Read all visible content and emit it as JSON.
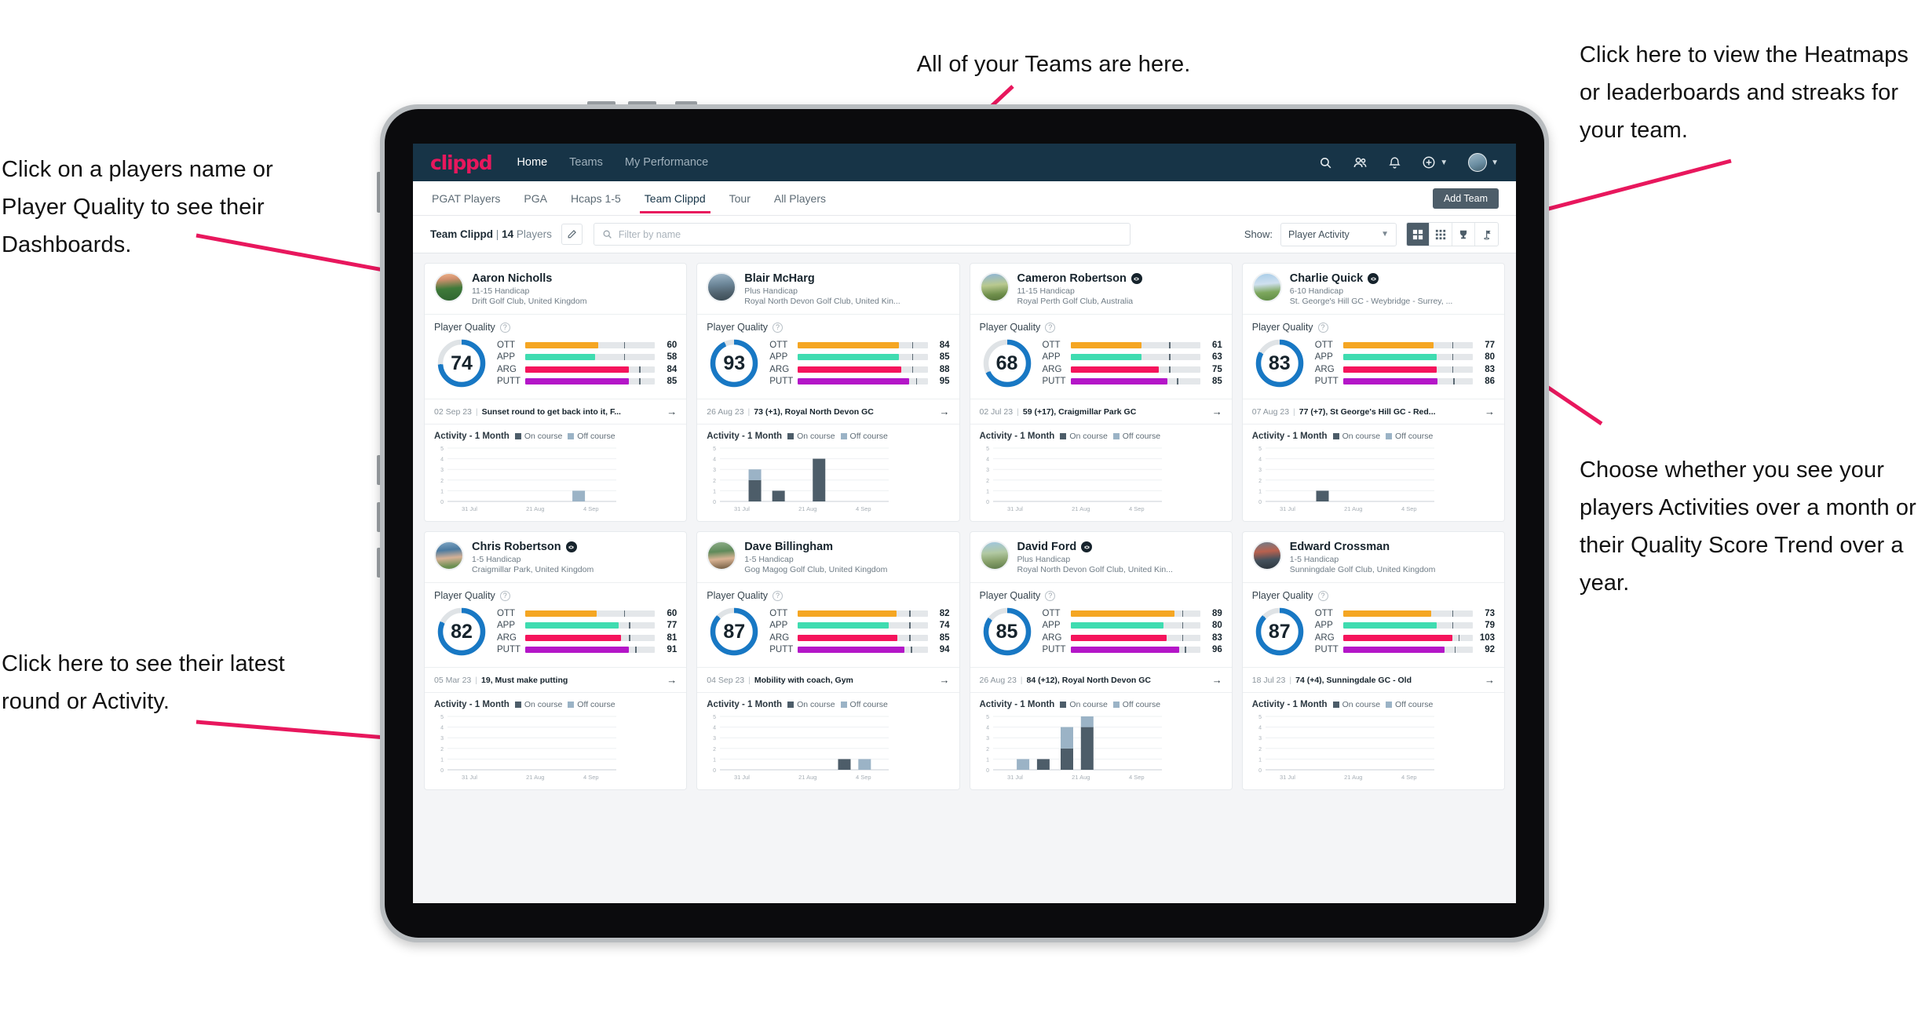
{
  "annotations": [
    {
      "id": "players-name",
      "text": "Click on a players name or Player Quality to see their Dashboards."
    },
    {
      "id": "teams",
      "text": "All of your Teams are here."
    },
    {
      "id": "heatmaps",
      "text": "Click here to view the Heatmaps or leaderboards and streaks for your team."
    },
    {
      "id": "activity-toggle",
      "text": "Choose whether you see your players Activities over a month or their Quality Score Trend over a year."
    },
    {
      "id": "latest-round",
      "text": "Click here to see their latest round or Activity."
    }
  ],
  "colors": {
    "brand_pink": "#e8175d",
    "header_navy": "#173447",
    "ring_blue": "#1878c4",
    "ott": "#f5a623",
    "app": "#3fdcb0",
    "arg": "#f5145c",
    "putt": "#b416c8",
    "on_course": "#4d5d69",
    "off_course": "#9bb3c6",
    "button_gray": "#4d5d69"
  },
  "app": {
    "logo": "clippd",
    "nav": [
      {
        "label": "Home",
        "active": true
      },
      {
        "label": "Teams",
        "active": false
      },
      {
        "label": "My Performance",
        "active": false
      }
    ],
    "header_icons": [
      {
        "name": "search-icon"
      },
      {
        "name": "people-icon"
      },
      {
        "name": "bell-icon"
      },
      {
        "name": "plus-circle-icon"
      },
      {
        "name": "avatar-icon"
      }
    ]
  },
  "tabs": [
    {
      "label": "PGAT Players",
      "active": false
    },
    {
      "label": "PGA",
      "active": false
    },
    {
      "label": "Hcaps 1-5",
      "active": false
    },
    {
      "label": "Team Clippd",
      "active": true
    },
    {
      "label": "Tour",
      "active": false
    },
    {
      "label": "All Players",
      "active": false
    }
  ],
  "add_team_label": "Add Team",
  "toolbar": {
    "team_name": "Team Clippd",
    "separator": "|",
    "player_count": "14",
    "players_word": "Players",
    "edit_icon": "pencil-icon",
    "filter_placeholder": "Filter by name",
    "filter_value": "",
    "show_label": "Show:",
    "show_value": "Player Activity",
    "show_options": [
      "Player Activity",
      "Quality Score Trend"
    ],
    "view_buttons": [
      {
        "name": "grid-view-icon",
        "active": true
      },
      {
        "name": "heatmap-view-icon",
        "active": false
      },
      {
        "name": "leaderboard-trophy-icon",
        "active": false
      },
      {
        "name": "streaks-flag-icon",
        "active": false
      }
    ]
  },
  "quality_section": {
    "title": "Player Quality",
    "help_icon": "question-mark-icon"
  },
  "activity_section": {
    "title": "Activity - 1 Month",
    "legend": [
      {
        "label": "On course",
        "color": "#4d5d69"
      },
      {
        "label": "Off course",
        "color": "#9bb3c6"
      }
    ],
    "y_ticks": [
      "5",
      "4",
      "3",
      "2",
      "1",
      "0"
    ],
    "x_ticks": [
      "31 Jul",
      "21 Aug",
      "4 Sep"
    ]
  },
  "metric_labels": [
    "OTT",
    "APP",
    "ARG",
    "PUTT"
  ],
  "players": [
    {
      "name": "Aaron Nicholls",
      "verified": false,
      "handicap": "11-15 Handicap",
      "club": "Drift Golf Club, United Kingdom",
      "quality_score": 74,
      "metrics": [
        {
          "label": "OTT",
          "value": 60,
          "fill_pct": 56,
          "tick_pct": 76
        },
        {
          "label": "APP",
          "value": 58,
          "fill_pct": 54,
          "tick_pct": 76
        },
        {
          "label": "ARG",
          "value": 84,
          "fill_pct": 80,
          "tick_pct": 88
        },
        {
          "label": "PUTT",
          "value": 85,
          "fill_pct": 80,
          "tick_pct": 88
        }
      ],
      "latest_date": "02 Sep 23",
      "latest_text": "Sunset round to get back into it, F...",
      "chart_data": {
        "type": "bar",
        "title": "Activity - 1 Month",
        "categories": [
          "31 Jul",
          "21 Aug",
          "4 Sep"
        ],
        "ylim": [
          0,
          5
        ],
        "bars": [
          {
            "pos": 0.74,
            "on_course": 0,
            "off_course": 1
          }
        ]
      }
    },
    {
      "name": "Blair McHarg",
      "verified": false,
      "handicap": "Plus Handicap",
      "club": "Royal North Devon Golf Club, United Kin...",
      "quality_score": 93,
      "metrics": [
        {
          "label": "OTT",
          "value": 84,
          "fill_pct": 78,
          "tick_pct": 88
        },
        {
          "label": "APP",
          "value": 85,
          "fill_pct": 78,
          "tick_pct": 88
        },
        {
          "label": "ARG",
          "value": 88,
          "fill_pct": 80,
          "tick_pct": 88
        },
        {
          "label": "PUTT",
          "value": 95,
          "fill_pct": 86,
          "tick_pct": 91
        }
      ],
      "latest_date": "26 Aug 23",
      "latest_text": "73 (+1), Royal North Devon GC",
      "chart_data": {
        "type": "bar",
        "title": "Activity - 1 Month",
        "categories": [
          "31 Jul",
          "21 Aug",
          "4 Sep"
        ],
        "ylim": [
          0,
          5
        ],
        "bars": [
          {
            "pos": 0.17,
            "on_course": 2,
            "off_course": 1
          },
          {
            "pos": 0.31,
            "on_course": 1,
            "off_course": 0
          },
          {
            "pos": 0.55,
            "on_course": 4,
            "off_course": 0
          }
        ]
      }
    },
    {
      "name": "Cameron Robertson",
      "verified": true,
      "handicap": "11-15 Handicap",
      "club": "Royal Perth Golf Club, Australia",
      "quality_score": 68,
      "metrics": [
        {
          "label": "OTT",
          "value": 61,
          "fill_pct": 55,
          "tick_pct": 76
        },
        {
          "label": "APP",
          "value": 63,
          "fill_pct": 55,
          "tick_pct": 76
        },
        {
          "label": "ARG",
          "value": 75,
          "fill_pct": 68,
          "tick_pct": 76
        },
        {
          "label": "PUTT",
          "value": 85,
          "fill_pct": 75,
          "tick_pct": 82
        }
      ],
      "latest_date": "02 Jul 23",
      "latest_text": "59 (+17), Craigmillar Park GC",
      "chart_data": {
        "type": "bar",
        "title": "Activity - 1 Month",
        "categories": [
          "31 Jul",
          "21 Aug",
          "4 Sep"
        ],
        "ylim": [
          0,
          5
        ],
        "bars": []
      }
    },
    {
      "name": "Charlie Quick",
      "verified": true,
      "handicap": "6-10 Handicap",
      "club": "St. George's Hill GC - Weybridge - Surrey, ...",
      "quality_score": 83,
      "metrics": [
        {
          "label": "OTT",
          "value": 77,
          "fill_pct": 70,
          "tick_pct": 84
        },
        {
          "label": "APP",
          "value": 80,
          "fill_pct": 72,
          "tick_pct": 84
        },
        {
          "label": "ARG",
          "value": 83,
          "fill_pct": 72,
          "tick_pct": 84
        },
        {
          "label": "PUTT",
          "value": 86,
          "fill_pct": 73,
          "tick_pct": 85
        }
      ],
      "latest_date": "07 Aug 23",
      "latest_text": "77 (+7), St George's Hill GC - Red...",
      "chart_data": {
        "type": "bar",
        "title": "Activity - 1 Month",
        "categories": [
          "31 Jul",
          "21 Aug",
          "4 Sep"
        ],
        "ylim": [
          0,
          5
        ],
        "bars": [
          {
            "pos": 0.3,
            "on_course": 1,
            "off_course": 0
          }
        ]
      }
    },
    {
      "name": "Chris Robertson",
      "verified": true,
      "handicap": "1-5 Handicap",
      "club": "Craigmillar Park, United Kingdom",
      "quality_score": 82,
      "metrics": [
        {
          "label": "OTT",
          "value": 60,
          "fill_pct": 55,
          "tick_pct": 76
        },
        {
          "label": "APP",
          "value": 77,
          "fill_pct": 72,
          "tick_pct": 80
        },
        {
          "label": "ARG",
          "value": 81,
          "fill_pct": 74,
          "tick_pct": 80
        },
        {
          "label": "PUTT",
          "value": 91,
          "fill_pct": 80,
          "tick_pct": 85
        }
      ],
      "latest_date": "05 Mar 23",
      "latest_text": "19, Must make putting",
      "chart_data": {
        "type": "bar",
        "title": "Activity - 1 Month",
        "categories": [
          "31 Jul",
          "21 Aug",
          "4 Sep"
        ],
        "ylim": [
          0,
          5
        ],
        "bars": []
      }
    },
    {
      "name": "Dave Billingham",
      "verified": false,
      "handicap": "1-5 Handicap",
      "club": "Gog Magog Golf Club, United Kingdom",
      "quality_score": 87,
      "metrics": [
        {
          "label": "OTT",
          "value": 82,
          "fill_pct": 76,
          "tick_pct": 86
        },
        {
          "label": "APP",
          "value": 74,
          "fill_pct": 70,
          "tick_pct": 86
        },
        {
          "label": "ARG",
          "value": 85,
          "fill_pct": 77,
          "tick_pct": 86
        },
        {
          "label": "PUTT",
          "value": 94,
          "fill_pct": 82,
          "tick_pct": 87
        }
      ],
      "latest_date": "04 Sep 23",
      "latest_text": "Mobility with coach, Gym",
      "chart_data": {
        "type": "bar",
        "title": "Activity - 1 Month",
        "categories": [
          "31 Jul",
          "21 Aug",
          "4 Sep"
        ],
        "ylim": [
          0,
          5
        ],
        "bars": [
          {
            "pos": 0.7,
            "on_course": 1,
            "off_course": 0
          },
          {
            "pos": 0.82,
            "on_course": 0,
            "off_course": 1
          }
        ]
      }
    },
    {
      "name": "David Ford",
      "verified": true,
      "handicap": "Plus Handicap",
      "club": "Royal North Devon Golf Club, United Kin...",
      "quality_score": 85,
      "metrics": [
        {
          "label": "OTT",
          "value": 89,
          "fill_pct": 80,
          "tick_pct": 86
        },
        {
          "label": "APP",
          "value": 80,
          "fill_pct": 72,
          "tick_pct": 86
        },
        {
          "label": "ARG",
          "value": 83,
          "fill_pct": 74,
          "tick_pct": 86
        },
        {
          "label": "PUTT",
          "value": 96,
          "fill_pct": 84,
          "tick_pct": 88
        }
      ],
      "latest_date": "26 Aug 23",
      "latest_text": "84 (+12), Royal North Devon GC",
      "chart_data": {
        "type": "bar",
        "title": "Activity - 1 Month",
        "categories": [
          "31 Jul",
          "21 Aug",
          "4 Sep"
        ],
        "ylim": [
          0,
          5
        ],
        "bars": [
          {
            "pos": 0.14,
            "on_course": 0,
            "off_course": 1
          },
          {
            "pos": 0.26,
            "on_course": 1,
            "off_course": 0
          },
          {
            "pos": 0.4,
            "on_course": 2,
            "off_course": 2
          },
          {
            "pos": 0.52,
            "on_course": 4,
            "off_course": 1
          }
        ]
      }
    },
    {
      "name": "Edward Crossman",
      "verified": false,
      "handicap": "1-5 Handicap",
      "club": "Sunningdale Golf Club, United Kingdom",
      "quality_score": 87,
      "metrics": [
        {
          "label": "OTT",
          "value": 73,
          "fill_pct": 68,
          "tick_pct": 84
        },
        {
          "label": "APP",
          "value": 79,
          "fill_pct": 72,
          "tick_pct": 84
        },
        {
          "label": "ARG",
          "value": 103,
          "fill_pct": 84,
          "tick_pct": 89
        },
        {
          "label": "PUTT",
          "value": 92,
          "fill_pct": 78,
          "tick_pct": 86
        }
      ],
      "latest_date": "18 Jul 23",
      "latest_text": "74 (+4), Sunningdale GC - Old",
      "chart_data": {
        "type": "bar",
        "title": "Activity - 1 Month",
        "categories": [
          "31 Jul",
          "21 Aug",
          "4 Sep"
        ],
        "ylim": [
          0,
          5
        ],
        "bars": []
      }
    }
  ]
}
